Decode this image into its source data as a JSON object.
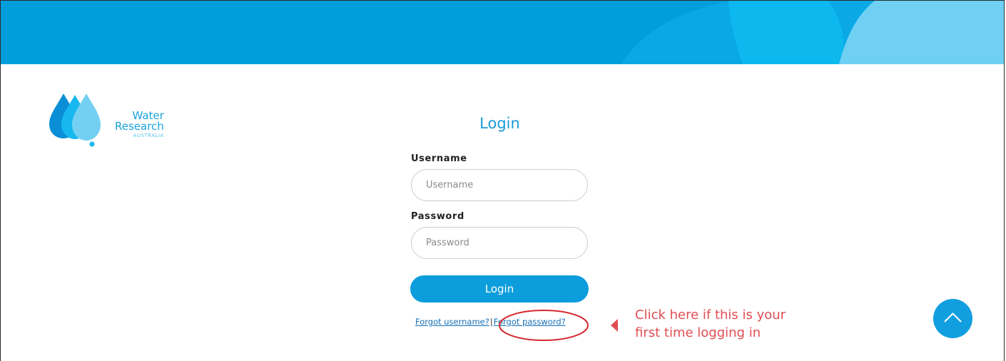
{
  "brand": {
    "line1": "Water",
    "line2": "Research",
    "line3": "AUSTRALIA",
    "primary_color": "#019edc",
    "light_color": "#6fd0f4"
  },
  "login": {
    "title": "Login",
    "username_label": "Username",
    "username_placeholder": "Username",
    "password_label": "Password",
    "password_placeholder": "Password",
    "button_label": "Login",
    "forgot_username": "Forgot username?",
    "separator": "|",
    "forgot_password": "Forgot password?"
  },
  "annotation": {
    "line1": "Click here if this is your",
    "line2": "first time logging in",
    "color": "#e04d52"
  },
  "scroll_top": {
    "icon": "chevron-up-icon"
  }
}
